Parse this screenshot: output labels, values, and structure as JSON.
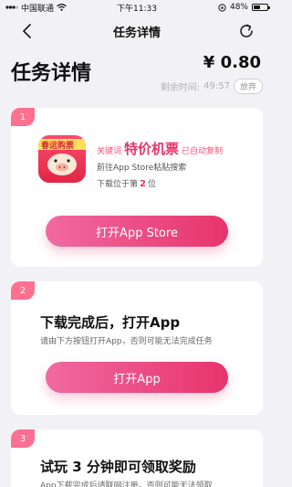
{
  "status": {
    "carrier": "中国联通",
    "time": "下午11:33",
    "battery": "48%",
    "battery_level": 0.48
  },
  "nav": {
    "title": "任务详情"
  },
  "header": {
    "page_title": "任务详情",
    "reward": "¥ 0.80",
    "remain_label": "剩余时间:",
    "remain_time": "49:57",
    "giveup_label": "放弃"
  },
  "steps": [
    {
      "number": "1",
      "app_icon_text": "春运购票",
      "keyword_prefix": "关键词",
      "keyword": "特价机票",
      "keyword_suffix": "已自动复制",
      "instruction": "前往App Store粘贴搜索",
      "rank_prefix": "下载位于第",
      "rank": "2",
      "rank_suffix": "位",
      "button": "打开App Store"
    },
    {
      "number": "2",
      "heading": "下载完成后，打开App",
      "sub": "请由下方按钮打开App，否则可能无法完成任务",
      "button": "打开App"
    },
    {
      "number": "3",
      "heading": "试玩 3 分钟即可领取奖励",
      "sub": "App下载完成后请联网注册，否则可能无法领取"
    }
  ]
}
